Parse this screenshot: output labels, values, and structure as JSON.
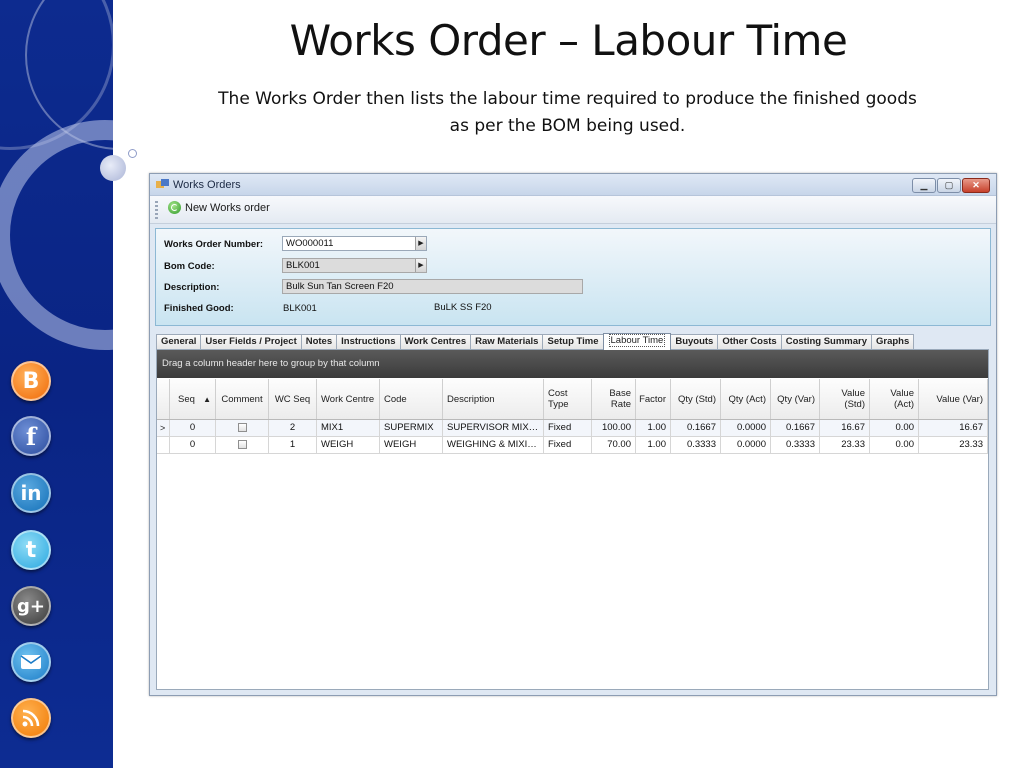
{
  "slide": {
    "title": "Works Order – Labour Time",
    "subtitle_line1": "The Works Order then lists the labour time required to produce the finished goods",
    "subtitle_line2": "as per the BOM being used."
  },
  "social_icons": [
    {
      "name": "blogger-icon",
      "glyph": "B"
    },
    {
      "name": "facebook-icon",
      "glyph": "f"
    },
    {
      "name": "linkedin-icon",
      "glyph": "in"
    },
    {
      "name": "twitter-icon",
      "glyph": "t"
    },
    {
      "name": "google-plus-icon",
      "glyph": "g+"
    },
    {
      "name": "email-icon",
      "glyph": "✉"
    },
    {
      "name": "rss-icon",
      "glyph": ")"
    }
  ],
  "window": {
    "title": "Works Orders",
    "toolbar": {
      "new_label": "New Works order"
    }
  },
  "header": {
    "works_order_number_label": "Works Order Number:",
    "works_order_number": "WO000011",
    "bom_code_label": "Bom Code:",
    "bom_code": "BLK001",
    "description_label": "Description:",
    "description": "Bulk Sun Tan Screen F20",
    "finished_good_label": "Finished Good:",
    "finished_good_code": "BLK001",
    "finished_good_desc": "BuLK SS F20"
  },
  "tabs": [
    "General",
    "User Fields / Project",
    "Notes",
    "Instructions",
    "Work Centres",
    "Raw Materials",
    "Setup Time",
    "Labour Time",
    "Buyouts",
    "Other Costs",
    "Costing Summary",
    "Graphs"
  ],
  "active_tab": "Labour Time",
  "grid": {
    "group_hint": "Drag a column header here to group by that column",
    "sort_indicator": "▲",
    "columns": [
      "Seq",
      "Comment",
      "WC Seq",
      "Work Centre",
      "Code",
      "Description",
      "Cost Type",
      "Base Rate",
      "Factor",
      "Qty (Std)",
      "Qty (Act)",
      "Qty (Var)",
      "Value (Std)",
      "Value (Act)",
      "Value (Var)"
    ],
    "rows": [
      {
        "indicator": ">",
        "seq": "0",
        "wc_seq": "2",
        "work_centre": "MIX1",
        "code": "SUPERMIX",
        "description": "SUPERVISOR MIXING",
        "cost_type": "Fixed",
        "base_rate": "100.00",
        "factor": "1.00",
        "qty_std": "0.1667",
        "qty_act": "0.0000",
        "qty_var": "0.1667",
        "value_std": "16.67",
        "value_act": "0.00",
        "value_var": "16.67"
      },
      {
        "indicator": "",
        "seq": "0",
        "wc_seq": "1",
        "work_centre": "WEIGH",
        "code": "WEIGH",
        "description": "WEIGHING & MIXING ...",
        "cost_type": "Fixed",
        "base_rate": "70.00",
        "factor": "1.00",
        "qty_std": "0.3333",
        "qty_act": "0.0000",
        "qty_var": "0.3333",
        "value_std": "23.33",
        "value_act": "0.00",
        "value_var": "23.33"
      }
    ]
  },
  "colors": {
    "band": "#0a2484",
    "header_panel": "#c9e4f1",
    "group_bar": "#3b3b3b"
  }
}
